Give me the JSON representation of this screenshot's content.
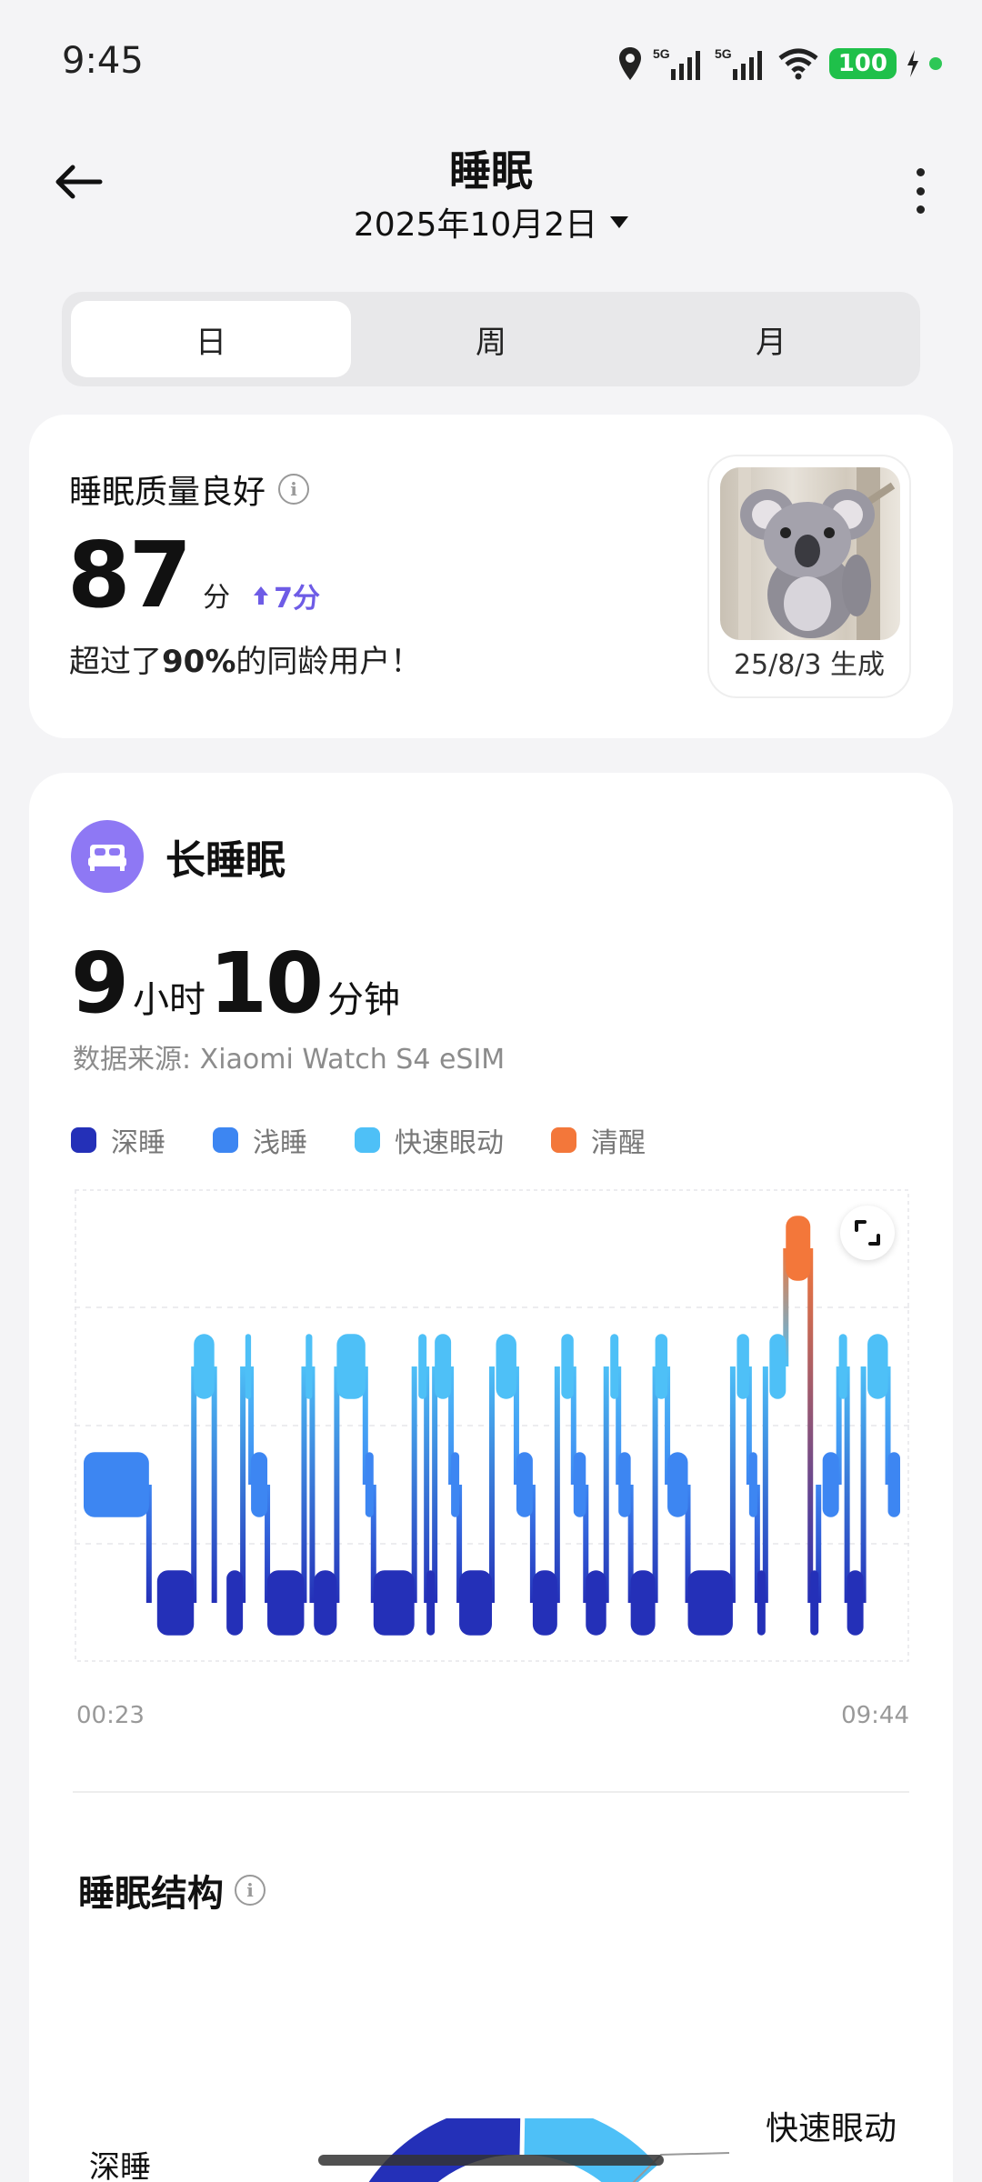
{
  "status_bar": {
    "time": "9:45",
    "net1": "5G",
    "net2": "5G",
    "battery": "100"
  },
  "header": {
    "title": "睡眠",
    "date": "2025年10月2日"
  },
  "tabs": [
    {
      "label": "日",
      "active": true
    },
    {
      "label": "周",
      "active": false
    },
    {
      "label": "月",
      "active": false
    }
  ],
  "quality": {
    "title": "睡眠质量良好",
    "score": "87",
    "score_unit": "分",
    "delta": "7分",
    "desc_prefix": "超过了",
    "desc_percent": "90%",
    "desc_suffix": "的同龄用户！",
    "badge_caption": "25/8/3 生成"
  },
  "long_sleep": {
    "label": "长睡眠",
    "hours": "9",
    "hours_unit": "小时",
    "minutes": "10",
    "minutes_unit": "分钟",
    "source": "数据来源: Xiaomi Watch S4 eSIM",
    "start_time": "00:23",
    "end_time": "09:44"
  },
  "legend": [
    {
      "label": "深睡",
      "color": "#2430b8"
    },
    {
      "label": "浅睡",
      "color": "#3d86f2"
    },
    {
      "label": "快速眼动",
      "color": "#4ec0f7"
    },
    {
      "label": "清醒",
      "color": "#f3773a"
    }
  ],
  "structure": {
    "title": "睡眠结构",
    "label_deep": "深睡",
    "label_rem": "快速眼动"
  },
  "chart_data": {
    "type": "timeline",
    "x_start": "00:23",
    "x_end": "09:44",
    "stage_levels": {
      "wake": 3,
      "rem": 2,
      "light": 1,
      "deep": 0
    },
    "colors": {
      "wake": "#f3773a",
      "rem": "#4ec0f7",
      "light": "#3d86f2",
      "deep": "#2430b8"
    },
    "segments": [
      {
        "stage": "light",
        "start": 0,
        "end": 0.08
      },
      {
        "stage": "deep",
        "start": 0.09,
        "end": 0.135
      },
      {
        "stage": "rem",
        "start": 0.135,
        "end": 0.16
      },
      {
        "stage": "deep",
        "start": 0.175,
        "end": 0.195
      },
      {
        "stage": "rem",
        "start": 0.198,
        "end": 0.205
      },
      {
        "stage": "light",
        "start": 0.205,
        "end": 0.225
      },
      {
        "stage": "deep",
        "start": 0.225,
        "end": 0.27
      },
      {
        "stage": "rem",
        "start": 0.272,
        "end": 0.28
      },
      {
        "stage": "deep",
        "start": 0.282,
        "end": 0.31
      },
      {
        "stage": "rem",
        "start": 0.31,
        "end": 0.345
      },
      {
        "stage": "light",
        "start": 0.345,
        "end": 0.355
      },
      {
        "stage": "deep",
        "start": 0.355,
        "end": 0.405
      },
      {
        "stage": "rem",
        "start": 0.41,
        "end": 0.42
      },
      {
        "stage": "deep",
        "start": 0.42,
        "end": 0.43
      },
      {
        "stage": "rem",
        "start": 0.43,
        "end": 0.45
      },
      {
        "stage": "light",
        "start": 0.45,
        "end": 0.46
      },
      {
        "stage": "deep",
        "start": 0.46,
        "end": 0.5
      },
      {
        "stage": "rem",
        "start": 0.505,
        "end": 0.53
      },
      {
        "stage": "light",
        "start": 0.53,
        "end": 0.55
      },
      {
        "stage": "deep",
        "start": 0.55,
        "end": 0.58
      },
      {
        "stage": "rem",
        "start": 0.585,
        "end": 0.6
      },
      {
        "stage": "light",
        "start": 0.6,
        "end": 0.615
      },
      {
        "stage": "deep",
        "start": 0.615,
        "end": 0.64
      },
      {
        "stage": "rem",
        "start": 0.645,
        "end": 0.655
      },
      {
        "stage": "light",
        "start": 0.655,
        "end": 0.67
      },
      {
        "stage": "deep",
        "start": 0.67,
        "end": 0.7
      },
      {
        "stage": "rem",
        "start": 0.7,
        "end": 0.715
      },
      {
        "stage": "light",
        "start": 0.715,
        "end": 0.74
      },
      {
        "stage": "deep",
        "start": 0.74,
        "end": 0.795
      },
      {
        "stage": "rem",
        "start": 0.8,
        "end": 0.815
      },
      {
        "stage": "light",
        "start": 0.815,
        "end": 0.825
      },
      {
        "stage": "deep",
        "start": 0.825,
        "end": 0.835
      },
      {
        "stage": "rem",
        "start": 0.84,
        "end": 0.86
      },
      {
        "stage": "wake",
        "start": 0.86,
        "end": 0.89
      },
      {
        "stage": "deep",
        "start": 0.89,
        "end": 0.9
      },
      {
        "stage": "light",
        "start": 0.905,
        "end": 0.925
      },
      {
        "stage": "rem",
        "start": 0.925,
        "end": 0.935
      },
      {
        "stage": "deep",
        "start": 0.935,
        "end": 0.955
      },
      {
        "stage": "rem",
        "start": 0.96,
        "end": 0.985
      },
      {
        "stage": "light",
        "start": 0.985,
        "end": 1.0
      }
    ]
  }
}
